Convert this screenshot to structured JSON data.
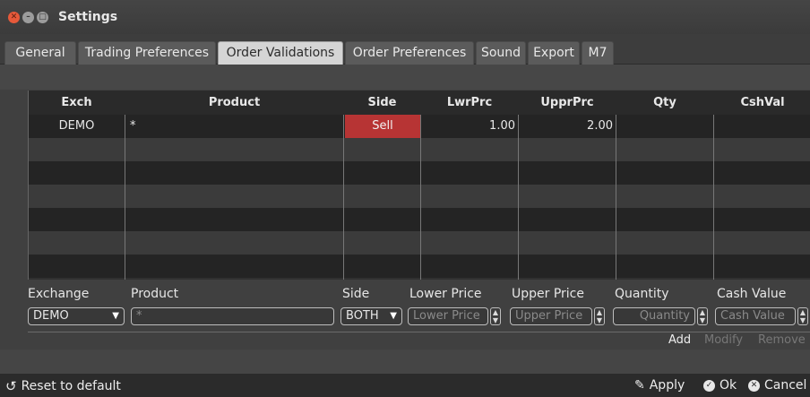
{
  "window": {
    "title": "Settings",
    "controls": {
      "close_icon": "close-icon",
      "minimize_icon": "minimize-icon",
      "maximize_icon": "maximize-icon"
    }
  },
  "tabs": [
    {
      "label": "General"
    },
    {
      "label": "Trading Preferences"
    },
    {
      "label": "Order Validations",
      "active": true
    },
    {
      "label": "Order Preferences"
    },
    {
      "label": "Sound"
    },
    {
      "label": "Export"
    },
    {
      "label": "M7"
    }
  ],
  "table": {
    "columns": [
      "Exch",
      "Product",
      "Side",
      "LwrPrc",
      "UpprPrc",
      "Qty",
      "CshVal"
    ],
    "rows": [
      {
        "exch": "DEMO",
        "product": "*",
        "side": "Sell",
        "lwrprc": "1.00",
        "upprprc": "2.00",
        "qty": "",
        "cshval": ""
      }
    ],
    "side_sell_color": "#b73434"
  },
  "form": {
    "labels": {
      "exchange": "Exchange",
      "product": "Product",
      "side": "Side",
      "lower_price": "Lower Price",
      "upper_price": "Upper Price",
      "quantity": "Quantity",
      "cash_value": "Cash Value"
    },
    "exchange_value": "DEMO",
    "product_placeholder": "*",
    "side_value": "BOTH",
    "lower_price_placeholder": "Lower Price",
    "upper_price_placeholder": "Upper Price",
    "quantity_placeholder": "Quantity",
    "cash_value_placeholder": "Cash Value"
  },
  "actions": {
    "add": "Add",
    "modify": "Modify",
    "remove": "Remove"
  },
  "footer": {
    "reset": "Reset to default",
    "apply": "Apply",
    "ok": "Ok",
    "cancel": "Cancel"
  }
}
